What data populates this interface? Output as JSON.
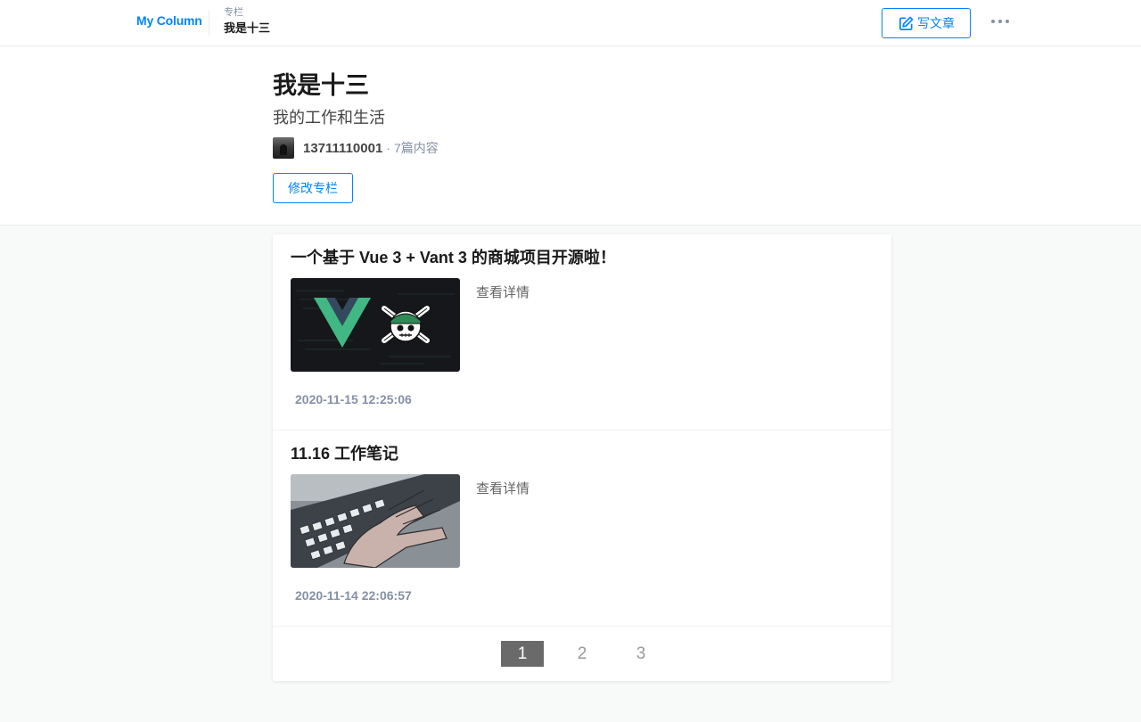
{
  "nav": {
    "brand": "My Column",
    "crumb_label": "专栏",
    "crumb_current": "我是十三",
    "write_label": "写文章",
    "write_icon": "edit-icon",
    "more_icon": "more-icon"
  },
  "column": {
    "title": "我是十三",
    "description": "我的工作和生活",
    "author": "13711110001",
    "separator": "·",
    "post_count": "7篇内容",
    "edit_label": "修改专栏"
  },
  "articles": [
    {
      "title": "一个基于 Vue 3 + Vant 3 的商城项目开源啦！",
      "read_more": "查看详情",
      "date": "2020-11-15 12:25:06"
    },
    {
      "title": "11.16 工作笔记",
      "read_more": "查看详情",
      "date": "2020-11-14 22:06:57"
    }
  ],
  "pagination": {
    "pages": [
      "1",
      "2",
      "3"
    ],
    "current": "1"
  },
  "colors": {
    "accent": "#0084ff",
    "muted": "#8590a6",
    "page_active_bg": "#6a6a6a"
  }
}
